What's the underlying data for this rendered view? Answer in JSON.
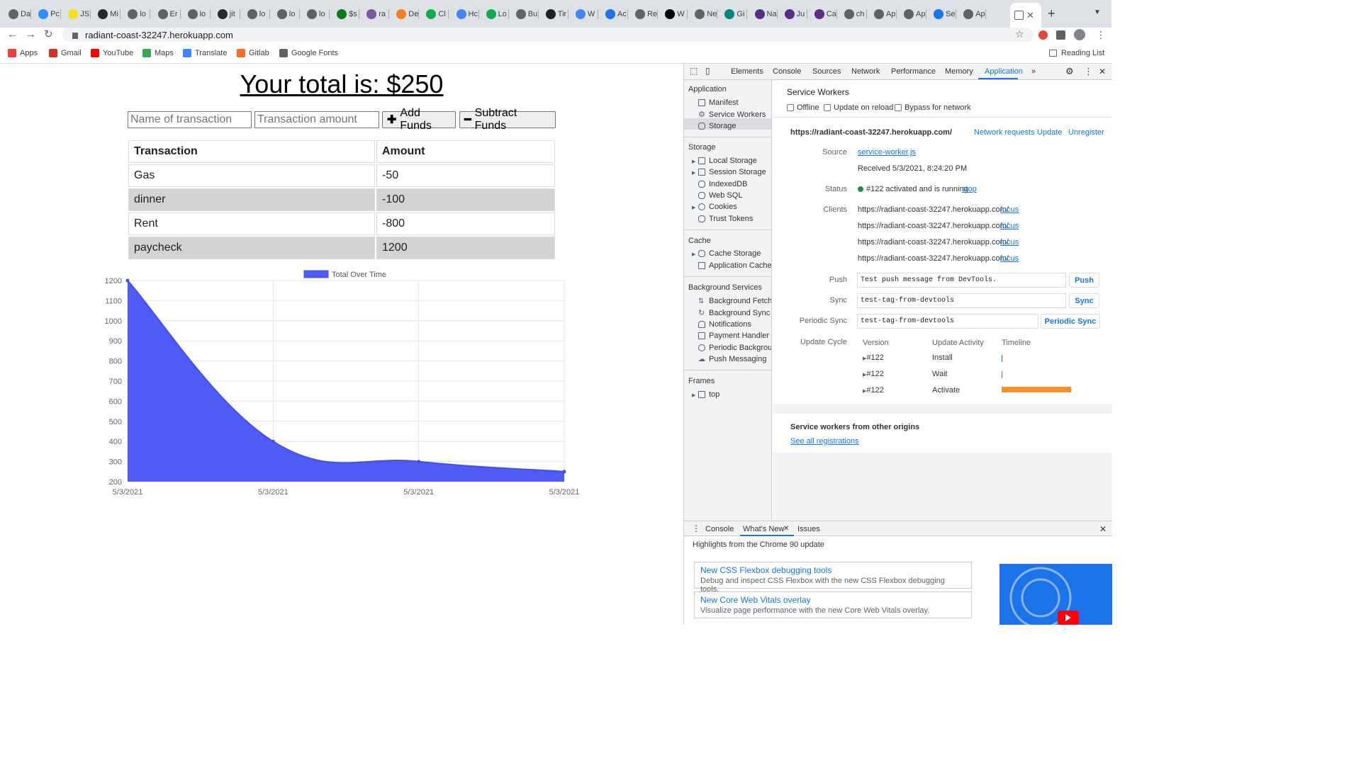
{
  "browser": {
    "tabs": [
      {
        "label": "Da",
        "color": "#5f6368"
      },
      {
        "label": "Pc",
        "color": "#2d8cff"
      },
      {
        "label": "JS",
        "color": "#f7df1e"
      },
      {
        "label": "Mi",
        "color": "#24292e"
      },
      {
        "label": "lo",
        "color": "#5f6368"
      },
      {
        "label": "Er",
        "color": "#5f6368"
      },
      {
        "label": "lo",
        "color": "#5f6368"
      },
      {
        "label": "jit",
        "color": "#24292e"
      },
      {
        "label": "lo",
        "color": "#5f6368"
      },
      {
        "label": "lo",
        "color": "#5f6368"
      },
      {
        "label": "lo",
        "color": "#5f6368"
      },
      {
        "label": "$s",
        "color": "#0d7a1a"
      },
      {
        "label": "ra",
        "color": "#79589f"
      },
      {
        "label": "De",
        "color": "#f38020"
      },
      {
        "label": "Cl",
        "color": "#13aa52"
      },
      {
        "label": "Hc",
        "color": "#4285f4"
      },
      {
        "label": "Lo",
        "color": "#13aa52"
      },
      {
        "label": "Bu",
        "color": "#5f6368"
      },
      {
        "label": "Tir",
        "color": "#202124"
      },
      {
        "label": "W",
        "color": "#4285f4"
      },
      {
        "label": "Ac",
        "color": "#1a73e8"
      },
      {
        "label": "Re",
        "color": "#5f6368"
      },
      {
        "label": "W",
        "color": "#000000"
      },
      {
        "label": "Ne",
        "color": "#5f6368"
      },
      {
        "label": "Gi",
        "color": "#00897b"
      },
      {
        "label": "Na",
        "color": "#5b2c83"
      },
      {
        "label": "Ju",
        "color": "#5b2c83"
      },
      {
        "label": "Ca",
        "color": "#5b2c83"
      },
      {
        "label": "ch",
        "color": "#5f6368"
      },
      {
        "label": "Ap",
        "color": "#5f6368"
      },
      {
        "label": "Ap",
        "color": "#5f6368"
      },
      {
        "label": "Se",
        "color": "#1a73e8"
      },
      {
        "label": "Ap",
        "color": "#5f6368"
      }
    ],
    "url": "radiant-coast-32247.herokuapp.com",
    "bookmarks": [
      {
        "label": "Apps",
        "color": "#ea4335"
      },
      {
        "label": "Gmail",
        "color": "#d93025"
      },
      {
        "label": "YouTube",
        "color": "#ff0000"
      },
      {
        "label": "Maps",
        "color": "#34a853"
      },
      {
        "label": "Translate",
        "color": "#4285f4"
      },
      {
        "label": "Gitlab",
        "color": "#fc6d26"
      },
      {
        "label": "Google Fonts",
        "color": "#5f6368"
      }
    ],
    "reading_list": "Reading List"
  },
  "page": {
    "total_label": "Your total is: $250",
    "name_placeholder": "Name of transaction",
    "amount_placeholder": "Transaction amount",
    "add_label": "Add Funds",
    "subtract_label": "Subtract Funds",
    "table": {
      "headers": [
        "Transaction",
        "Amount"
      ],
      "rows": [
        {
          "name": "Gas",
          "amount": "-50"
        },
        {
          "name": "dinner",
          "amount": "-100"
        },
        {
          "name": "Rent",
          "amount": "-800"
        },
        {
          "name": "paycheck",
          "amount": "1200"
        }
      ]
    }
  },
  "chart_data": {
    "type": "area",
    "x": [
      "5/3/2021",
      "5/3/2021",
      "5/3/2021",
      "5/3/2021"
    ],
    "series": [
      {
        "name": "Total Over Time",
        "values": [
          1200,
          400,
          300,
          250
        ],
        "color": "#4f5bf5"
      }
    ],
    "ylim": [
      200,
      1200
    ],
    "yticks": [
      200,
      300,
      400,
      500,
      600,
      700,
      800,
      900,
      1000,
      1100,
      1200
    ],
    "grid": true,
    "legend": "top"
  },
  "devtools": {
    "tabs": [
      "Elements",
      "Console",
      "Sources",
      "Network",
      "Performance",
      "Memory",
      "Application"
    ],
    "active_tab": "Application",
    "sidebar": {
      "application_head": "Application",
      "application_items": [
        "Manifest",
        "Service Workers",
        "Storage"
      ],
      "storage_head": "Storage",
      "storage_items": [
        "Local Storage",
        "Session Storage",
        "IndexedDB",
        "Web SQL",
        "Cookies",
        "Trust Tokens"
      ],
      "cache_head": "Cache",
      "cache_items": [
        "Cache Storage",
        "Application Cache"
      ],
      "bg_head": "Background Services",
      "bg_items": [
        "Background Fetch",
        "Background Sync",
        "Notifications",
        "Payment Handler",
        "Periodic Background Sync",
        "Push Messaging"
      ],
      "frames_head": "Frames",
      "frames_items": [
        "top"
      ]
    },
    "service_workers": {
      "title": "Service Workers",
      "options": [
        "Offline",
        "Update on reload",
        "Bypass for network"
      ],
      "origin": "https://radiant-coast-32247.herokuapp.com/",
      "links": [
        "Network requests",
        "Update",
        "Unregister"
      ],
      "source_label": "Source",
      "source_file": "service-worker.js",
      "received": "Received 5/3/2021, 8:24:20 PM",
      "status_label": "Status",
      "status_text": "#122 activated and is running",
      "stop_label": "stop",
      "clients_label": "Clients",
      "clients": [
        "https://radiant-coast-32247.herokuapp.com/",
        "https://radiant-coast-32247.herokuapp.com/",
        "https://radiant-coast-32247.herokuapp.com/",
        "https://radiant-coast-32247.herokuapp.com/"
      ],
      "focus_label": "focus",
      "push_label": "Push",
      "push_value": "Test push message from DevTools.",
      "push_button": "Push",
      "sync_label": "Sync",
      "sync_value": "test-tag-from-devtools",
      "sync_button": "Sync",
      "periodic_label": "Periodic Sync",
      "periodic_value": "test-tag-from-devtools",
      "periodic_button": "Periodic Sync",
      "update_cycle_label": "Update Cycle",
      "uc_headers": [
        "Version",
        "Update Activity",
        "Timeline"
      ],
      "uc_rows": [
        {
          "version": "#122",
          "activity": "Install",
          "color": "#1a73e8"
        },
        {
          "version": "#122",
          "activity": "Wait",
          "color": "#a142f4"
        },
        {
          "version": "#122",
          "activity": "Activate",
          "color": "#f9922b"
        }
      ],
      "other_origins_title": "Service workers from other origins",
      "see_all": "See all registrations"
    },
    "drawer": {
      "tabs": [
        "Console",
        "What's New",
        "Issues"
      ],
      "active": "What's New",
      "heading": "Highlights from the Chrome 90 update",
      "cards": [
        {
          "title": "New CSS Flexbox debugging tools",
          "desc": "Debug and inspect CSS Flexbox with the new CSS Flexbox debugging tools."
        },
        {
          "title": "New Core Web Vitals overlay",
          "desc": "Visualize page performance with the new Core Web Vitals overlay."
        }
      ]
    }
  }
}
